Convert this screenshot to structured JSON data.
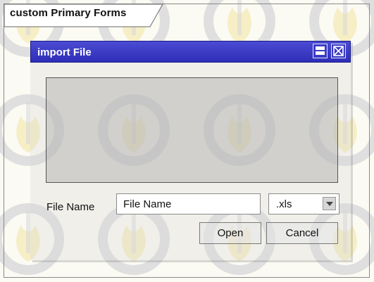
{
  "frame": {
    "tab_label": "custom Primary Forms"
  },
  "dialog": {
    "title": "import File",
    "maximize_icon": "maximize-icon",
    "close_icon": "close-icon",
    "file_name_label": "File Name",
    "file_name_value": "File Name",
    "extension_value": ".xls",
    "open_label": "Open",
    "cancel_label": "Cancel"
  },
  "colors": {
    "titlebar": "#3636c4",
    "background": "#fbfaf3"
  }
}
